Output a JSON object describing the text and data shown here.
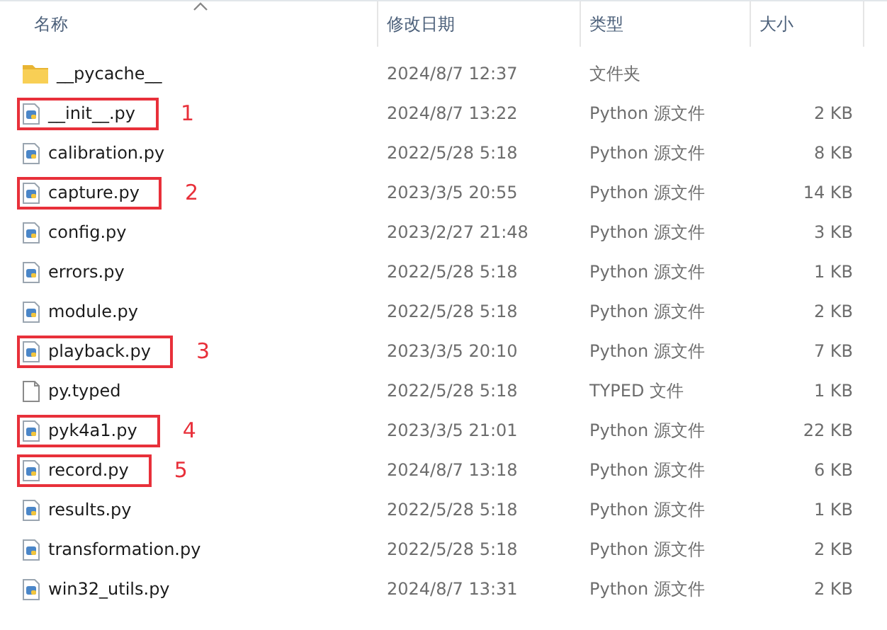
{
  "columns": [
    {
      "label": "名称",
      "sorted": true
    },
    {
      "label": "修改日期",
      "sorted": false
    },
    {
      "label": "类型",
      "sorted": false
    },
    {
      "label": "大小",
      "sorted": false
    }
  ],
  "files": [
    {
      "kind": "folder",
      "name": "__pycache__",
      "modified": "2024/8/7 12:37",
      "type": "文件夹"
    },
    {
      "kind": "python",
      "name": "__init__.py",
      "modified": "2024/8/7 13:22",
      "type": "Python 源文件",
      "size": "2 KB",
      "annotation": "1"
    },
    {
      "kind": "python",
      "name": "calibration.py",
      "modified": "2022/5/28 5:18",
      "type": "Python 源文件",
      "size": "8 KB"
    },
    {
      "kind": "python",
      "name": "capture.py",
      "modified": "2023/3/5 20:55",
      "type": "Python 源文件",
      "size": "14 KB",
      "annotation": "2"
    },
    {
      "kind": "python",
      "name": "config.py",
      "modified": "2023/2/27 21:48",
      "type": "Python 源文件",
      "size": "3 KB"
    },
    {
      "kind": "python",
      "name": "errors.py",
      "modified": "2022/5/28 5:18",
      "type": "Python 源文件",
      "size": "1 KB"
    },
    {
      "kind": "python",
      "name": "module.py",
      "modified": "2022/5/28 5:18",
      "type": "Python 源文件",
      "size": "2 KB"
    },
    {
      "kind": "python",
      "name": "playback.py",
      "modified": "2023/3/5 20:10",
      "type": "Python 源文件",
      "size": "7 KB",
      "annotation": "3"
    },
    {
      "kind": "file",
      "name": "py.typed",
      "modified": "2022/5/28 5:18",
      "type": "TYPED 文件",
      "size": "1 KB"
    },
    {
      "kind": "python",
      "name": "pyk4a1.py",
      "modified": "2023/3/5 21:01",
      "type": "Python 源文件",
      "size": "22 KB",
      "annotation": "4"
    },
    {
      "kind": "python",
      "name": "record.py",
      "modified": "2024/8/7 13:18",
      "type": "Python 源文件",
      "size": "6 KB",
      "annotation": "5"
    },
    {
      "kind": "python",
      "name": "results.py",
      "modified": "2022/5/28 5:18",
      "type": "Python 源文件",
      "size": "1 KB"
    },
    {
      "kind": "python",
      "name": "transformation.py",
      "modified": "2022/5/28 5:18",
      "type": "Python 源文件",
      "size": "2 KB"
    },
    {
      "kind": "python",
      "name": "win32_utils.py",
      "modified": "2024/8/7 13:31",
      "type": "Python 源文件",
      "size": "2 KB"
    }
  ]
}
